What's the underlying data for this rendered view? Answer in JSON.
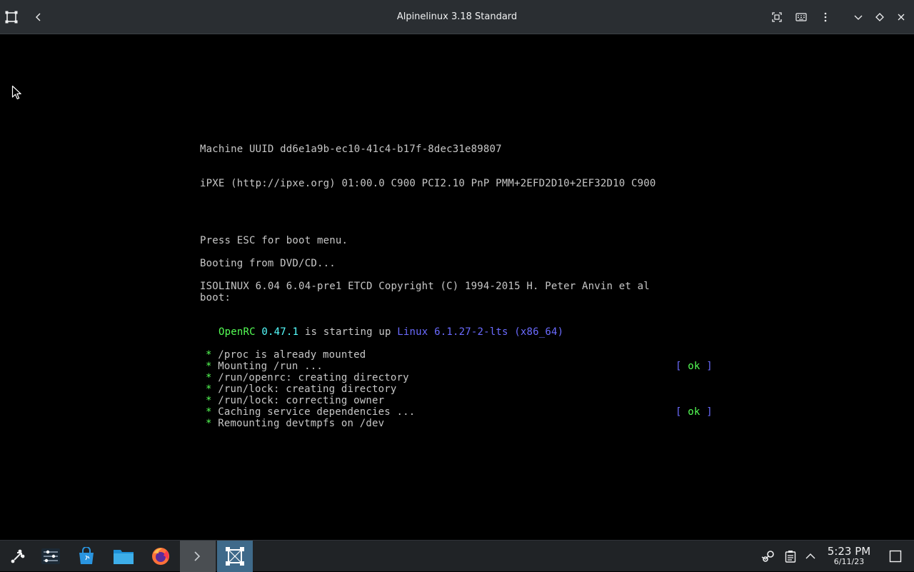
{
  "window": {
    "title": "Alpinelinux 3.18 Standard",
    "icons": {
      "app": "vm-app-icon",
      "back": "chevron-left-icon",
      "fullscreen": "fullscreen-icon",
      "keyboard": "keyboard-icon",
      "menu": "kebab-menu-icon",
      "minimize": "chevron-down-icon",
      "maximize": "diamond-icon",
      "close": "close-icon"
    }
  },
  "console": {
    "lines": {
      "uuid": "Machine UUID dd6e1a9b-ec10-41c4-b17f-8dec31e89807",
      "ipxe": "iPXE (http://ipxe.org) 01:00.0 C900 PCI2.10 PnP PMM+2EFD2D10+2EF32D10 C900",
      "press_esc": "Press ESC for boot menu.",
      "booting": "Booting from DVD/CD...",
      "isolinux": "ISOLINUX 6.04 6.04-pre1 ETCD Copyright (C) 1994-2015 H. Peter Anvin et al",
      "boot_prompt": "boot:"
    },
    "openrc": {
      "name": "OpenRC",
      "version": "0.47.1",
      "middle": "is starting up",
      "kernel": "Linux 6.1.27-2-lts (x86_64)"
    },
    "services": [
      {
        "bullet": "*",
        "text": "/proc is already mounted",
        "status": ""
      },
      {
        "bullet": "*",
        "text": "Mounting /run ...",
        "status": "ok"
      },
      {
        "bullet": "*",
        "text": "/run/openrc: creating directory",
        "status": ""
      },
      {
        "bullet": "*",
        "text": "/run/lock: creating directory",
        "status": ""
      },
      {
        "bullet": "*",
        "text": "/run/lock: correcting owner",
        "status": ""
      },
      {
        "bullet": "*",
        "text": "Caching service dependencies ...",
        "status": "ok"
      },
      {
        "bullet": "*",
        "text": "Remounting devtmpfs on /dev",
        "status": ""
      }
    ],
    "status_open": "[",
    "status_close": "]"
  },
  "taskbar": {
    "apps": [
      {
        "name": "app-launcher-icon"
      },
      {
        "name": "system-settings-icon"
      },
      {
        "name": "discover-store-icon"
      },
      {
        "name": "file-manager-icon"
      },
      {
        "name": "firefox-icon"
      },
      {
        "name": "terminal-icon"
      },
      {
        "name": "vm-manager-icon"
      }
    ],
    "tray": [
      "steam-icon",
      "clipboard-icon",
      "chevron-up-icon"
    ],
    "clock": {
      "time": "5:23 PM",
      "date": "6/11/23"
    },
    "show_desktop": "show-desktop-icon"
  },
  "colors": {
    "titlebar_bg": "#2a2e32",
    "taskbar_bg": "#202326",
    "console_text": "#c7c7c7",
    "openrc_green": "#55ff55",
    "kernel_blue": "#6b6bff",
    "ok_green": "#55ff55",
    "active_task": "#3f6a8a"
  }
}
